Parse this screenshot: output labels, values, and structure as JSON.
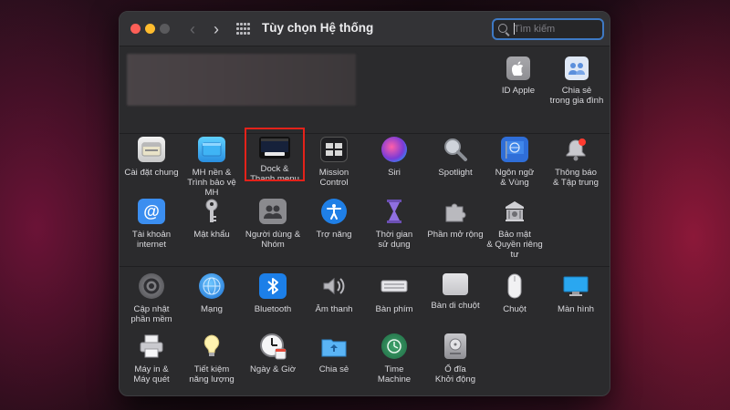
{
  "window": {
    "title": "Tùy chọn Hệ thống"
  },
  "search": {
    "placeholder": "Tìm kiếm",
    "value": ""
  },
  "colors": {
    "accent": "#3e79c4",
    "highlight": "#e3221a",
    "window_bg": "#2b2b2d"
  },
  "account_panes": [
    {
      "label": "ID Apple",
      "icon": "apple-logo-icon"
    },
    {
      "label": "Chia sẻ\ntrong gia đình",
      "icon": "family-sharing-icon"
    }
  ],
  "panes_row1": [
    {
      "label": "Cài đặt chung",
      "icon": "general-icon"
    },
    {
      "label": "MH nền &\nTrình bảo vệ MH",
      "icon": "desktop-screensaver-icon"
    },
    {
      "label": "Dock &\nThanh menu",
      "icon": "dock-menubar-icon",
      "highlighted": true
    },
    {
      "label": "Mission\nControl",
      "icon": "mission-control-icon"
    },
    {
      "label": "Siri",
      "icon": "siri-icon"
    },
    {
      "label": "Spotlight",
      "icon": "spotlight-icon"
    },
    {
      "label": "Ngôn ngữ\n& Vùng",
      "icon": "language-region-icon"
    },
    {
      "label": "Thông báo\n& Tập trung",
      "icon": "notifications-icon"
    }
  ],
  "panes_row2": [
    {
      "label": "Tài khoản\ninternet",
      "icon": "internet-accounts-icon"
    },
    {
      "label": "Mật khẩu",
      "icon": "passwords-icon"
    },
    {
      "label": "Người dùng &\nNhóm",
      "icon": "users-groups-icon"
    },
    {
      "label": "Trợ năng",
      "icon": "accessibility-icon"
    },
    {
      "label": "Thời gian\nsử dụng",
      "icon": "screen-time-icon"
    },
    {
      "label": "Phần mở rộng",
      "icon": "extensions-icon"
    },
    {
      "label": "Bảo mật\n& Quyền riêng tư",
      "icon": "security-privacy-icon"
    }
  ],
  "panes_row3": [
    {
      "label": "Cập nhật\nphần mềm",
      "icon": "software-update-icon"
    },
    {
      "label": "Mạng",
      "icon": "network-icon"
    },
    {
      "label": "Bluetooth",
      "icon": "bluetooth-icon"
    },
    {
      "label": "Âm thanh",
      "icon": "sound-icon"
    },
    {
      "label": "Bàn phím",
      "icon": "keyboard-icon"
    },
    {
      "label": "Bàn di chuột",
      "icon": "trackpad-icon"
    },
    {
      "label": "Chuột",
      "icon": "mouse-icon"
    },
    {
      "label": "Màn hình",
      "icon": "displays-icon"
    }
  ],
  "panes_row4": [
    {
      "label": "Máy in &\nMáy quét",
      "icon": "printers-scanners-icon"
    },
    {
      "label": "Tiết kiệm\nnăng lượng",
      "icon": "energy-saver-icon"
    },
    {
      "label": "Ngày & Giờ",
      "icon": "date-time-icon"
    },
    {
      "label": "Chia sẻ",
      "icon": "sharing-icon"
    },
    {
      "label": "Time\nMachine",
      "icon": "time-machine-icon"
    },
    {
      "label": "Ổ đĩa\nKhởi động",
      "icon": "startup-disk-icon"
    }
  ]
}
